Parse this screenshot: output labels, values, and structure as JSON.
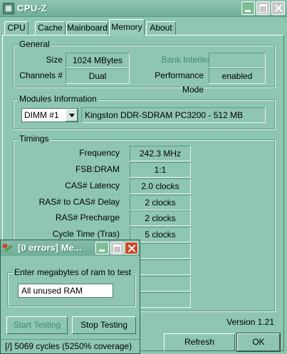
{
  "window": {
    "title": "CPU-Z"
  },
  "tabs": [
    {
      "label": "CPU"
    },
    {
      "label": "Cache"
    },
    {
      "label": "Mainboard"
    },
    {
      "label": "Memory",
      "active": true
    },
    {
      "label": "About"
    }
  ],
  "general": {
    "title": "General",
    "size_label": "Size",
    "size_value": "1024 MBytes",
    "bank_interleave_label": "Bank Interleave",
    "bank_interleave_value": "",
    "channels_label": "Channels #",
    "channels_value": "Dual",
    "performance_mode_label": "Performance Mode",
    "performance_mode_value": "enabled"
  },
  "modules": {
    "title": "Modules Information",
    "selected_slot": "DIMM #1",
    "module_description": "Kingston DDR-SDRAM PC3200 - 512 MB"
  },
  "timings": {
    "title": "Timings",
    "rows": [
      {
        "label": "Frequency",
        "value": "242.3 MHz"
      },
      {
        "label": "FSB:DRAM",
        "value": "1:1"
      },
      {
        "label": "CAS# Latency",
        "value": "2.0 clocks"
      },
      {
        "label": "RAS# to CAS# Delay",
        "value": "2 clocks"
      },
      {
        "label": "RAS# Precharge",
        "value": "2 clocks"
      },
      {
        "label": "Cycle Time (Tras)",
        "value": "5 clocks"
      },
      {
        "label": "",
        "value": ""
      },
      {
        "label": "",
        "value": ""
      },
      {
        "label": "",
        "value": ""
      },
      {
        "label": "",
        "value": ""
      }
    ]
  },
  "version": "Version 1.21",
  "buttons": {
    "refresh": "Refresh",
    "ok": "OK"
  },
  "memtest": {
    "title": "[0 errors] Me...",
    "group_label": "Enter megabytes of ram to test",
    "input_value": "All unused RAM",
    "start_button": "Start Testing",
    "stop_button": "Stop Testing",
    "status_prefix": "[/]",
    "status_text": "5069 cycles (5250% coverage)"
  },
  "colors": {
    "background": "#8ec6b2",
    "title_bar": "#6faf9a",
    "disabled_text": "#3f8a72"
  }
}
